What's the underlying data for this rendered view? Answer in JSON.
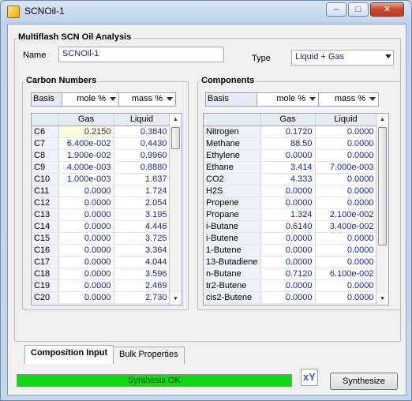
{
  "window": {
    "title": "SCNOil-1",
    "min_glyph": "–",
    "max_glyph": "□",
    "close_glyph": "✕"
  },
  "analysis": {
    "group_title": "Multiflash SCN Oil Analysis",
    "name_label": "Name",
    "name_value": "SCNOil-1",
    "type_label": "Type",
    "type_value": "Liquid + Gas"
  },
  "carbon": {
    "group_title": "Carbon Numbers",
    "basis_label": "Basis",
    "basis_gas": "mole %",
    "basis_liquid": "mass %",
    "columns": [
      "Gas",
      "Liquid"
    ],
    "rows": [
      [
        "C6",
        "0.2150",
        "0.3840"
      ],
      [
        "C7",
        "6.400e-002",
        "0.4430"
      ],
      [
        "C8",
        "1.900e-002",
        "0.9960"
      ],
      [
        "C9",
        "4.000e-003",
        "0.8880"
      ],
      [
        "C10",
        "1.000e-003",
        "1.637"
      ],
      [
        "C11",
        "0.0000",
        "1.724"
      ],
      [
        "C12",
        "0.0000",
        "2.054"
      ],
      [
        "C13",
        "0.0000",
        "3.195"
      ],
      [
        "C14",
        "0.0000",
        "4.446"
      ],
      [
        "C15",
        "0.0000",
        "3.725"
      ],
      [
        "C16",
        "0.0000",
        "3.364"
      ],
      [
        "C17",
        "0.0000",
        "4.044"
      ],
      [
        "C18",
        "0.0000",
        "3.596"
      ],
      [
        "C19",
        "0.0000",
        "2.469"
      ],
      [
        "C20",
        "0.0000",
        "2.730"
      ]
    ]
  },
  "components": {
    "group_title": "Components",
    "basis_label": "Basis",
    "basis_gas": "mole %",
    "basis_liquid": "mass %",
    "columns": [
      "Gas",
      "Liquid"
    ],
    "rows": [
      [
        "Nitrogen",
        "0.1720",
        "0.0000"
      ],
      [
        "Methane",
        "88.50",
        "0.0000"
      ],
      [
        "Ethylene",
        "0.0000",
        "0.0000"
      ],
      [
        "Ethane",
        "3.414",
        "7.000e-003"
      ],
      [
        "CO2",
        "4.333",
        "0.0000"
      ],
      [
        "H2S",
        "0.0000",
        "0.0000"
      ],
      [
        "Propene",
        "0.0000",
        "0.0000"
      ],
      [
        "Propane",
        "1.324",
        "2.100e-002"
      ],
      [
        "i-Butane",
        "0.6140",
        "3.400e-002"
      ],
      [
        "i-Butene",
        "0.0000",
        "0.0000"
      ],
      [
        "1-Butene",
        "0.0000",
        "0.0000"
      ],
      [
        "13-Butadiene",
        "0.0000",
        "0.0000"
      ],
      [
        "n-Butane",
        "0.7120",
        "6.100e-002"
      ],
      [
        "tr2-Butene",
        "0.0000",
        "0.0000"
      ],
      [
        "cis2-Butene",
        "0.0000",
        "0.0000"
      ]
    ]
  },
  "tabs": [
    "Composition Input",
    "Bulk Properties"
  ],
  "status": {
    "text": "Synthesis OK",
    "progress": 1.0
  },
  "chart_icon_glyph": "xY",
  "synthesize_label": "Synthesize"
}
